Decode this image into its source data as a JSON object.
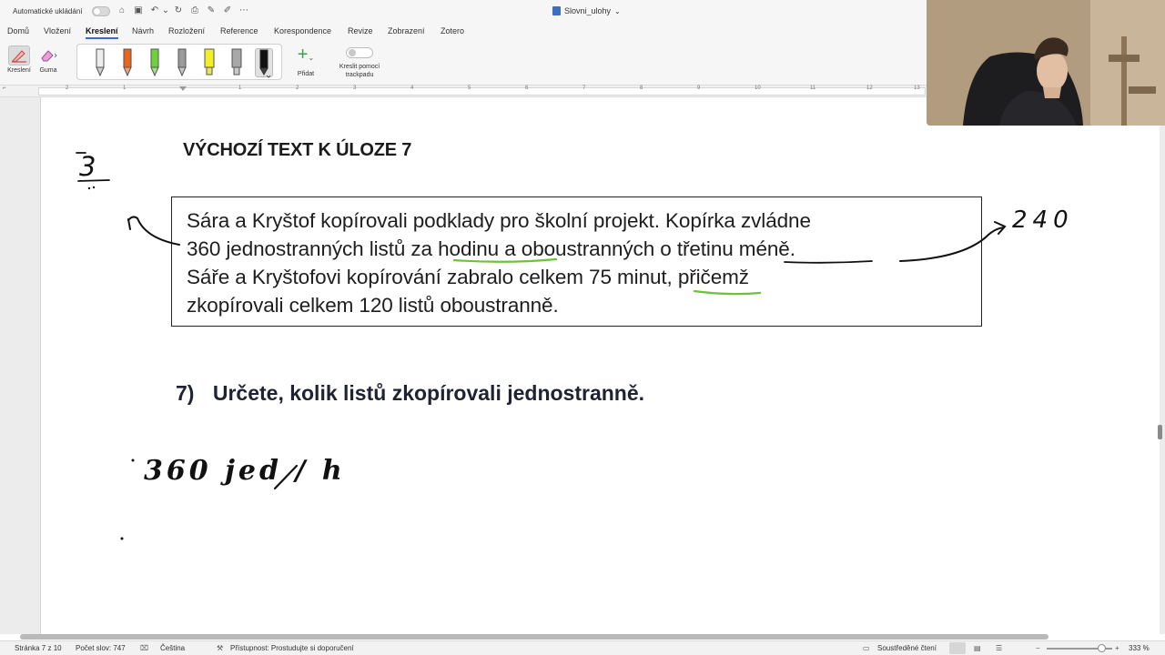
{
  "titlebar": {
    "autosave_label": "Automatické ukládání",
    "document_title": "Slovni_ulohy"
  },
  "menu": {
    "tabs": [
      "Domů",
      "Vložení",
      "Kreslení",
      "Návrh",
      "Rozložení",
      "Reference",
      "Korespondence",
      "Revize",
      "Zobrazení",
      "Zotero"
    ],
    "active_tab": "Kreslení"
  },
  "ribbon": {
    "draw_label": "Kreslení",
    "eraser_label": "Guma",
    "add_label": "Přidat",
    "trackpad_label_1": "Kreslit pomocí",
    "trackpad_label_2": "trackpadu",
    "pen_colors": [
      "#cfcfcf",
      "#e8651e",
      "#6ed33b",
      "#9c9c9c",
      "#f2ee2a",
      "#a8a8a8",
      "#111111"
    ]
  },
  "ruler": {
    "numbers": [
      "2",
      "1",
      "1",
      "2",
      "3",
      "4",
      "5",
      "6",
      "7",
      "8",
      "9",
      "10",
      "11",
      "12",
      "13"
    ]
  },
  "document": {
    "heading": "VÝCHOZÍ TEXT K ÚLOZE 7",
    "task_lines": [
      "Sára a Kryštof kopírovali podklady pro školní projekt. Kopírka zvládne",
      "360 jednostranných listů za hodinu a oboustranných o třetinu méně.",
      "Sáře a Kryštofovi kopírování zabralo celkem 75 minut, přičemž",
      "zkopírovali celkem 120 listů oboustranně."
    ],
    "question_number": "7)",
    "question_text": "Určete, kolik listů zkopírovali jednostranně."
  },
  "handwriting": {
    "note_left": "3",
    "note_right": "240",
    "note_bottom": "360 jed / h"
  },
  "statusbar": {
    "page": "Stránka 7 z 10",
    "words": "Počet slov: 747",
    "language": "Čeština",
    "accessibility": "Přístupnost: Prostudujte si doporučení",
    "focus": "Soustředěné čtení",
    "zoom": "333 %"
  },
  "colors": {
    "accent": "#2f6fd6",
    "highlight_green": "#6cc23b",
    "ink": "#111111"
  }
}
